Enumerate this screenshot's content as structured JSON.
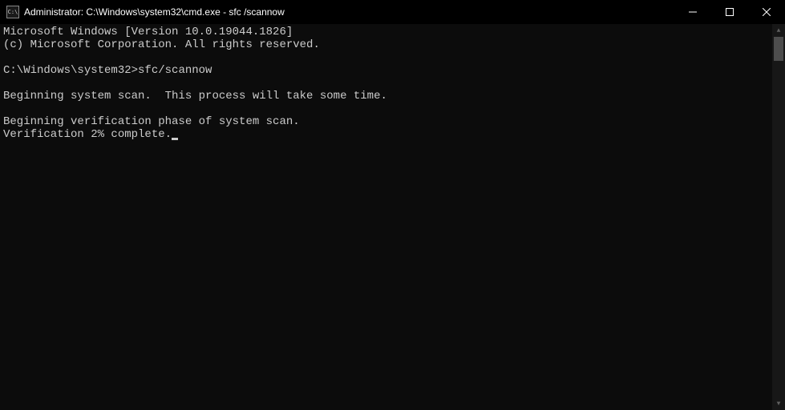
{
  "titlebar": {
    "icon_label": "C:\\",
    "title": "Administrator: C:\\Windows\\system32\\cmd.exe - sfc /scannow"
  },
  "terminal": {
    "line1": "Microsoft Windows [Version 10.0.19044.1826]",
    "line2": "(c) Microsoft Corporation. All rights reserved.",
    "blank1": "",
    "prompt": "C:\\Windows\\system32>",
    "command": "sfc/scannow",
    "blank2": "",
    "line3": "Beginning system scan.  This process will take some time.",
    "blank3": "",
    "line4": "Beginning verification phase of system scan.",
    "line5": "Verification 2% complete."
  }
}
